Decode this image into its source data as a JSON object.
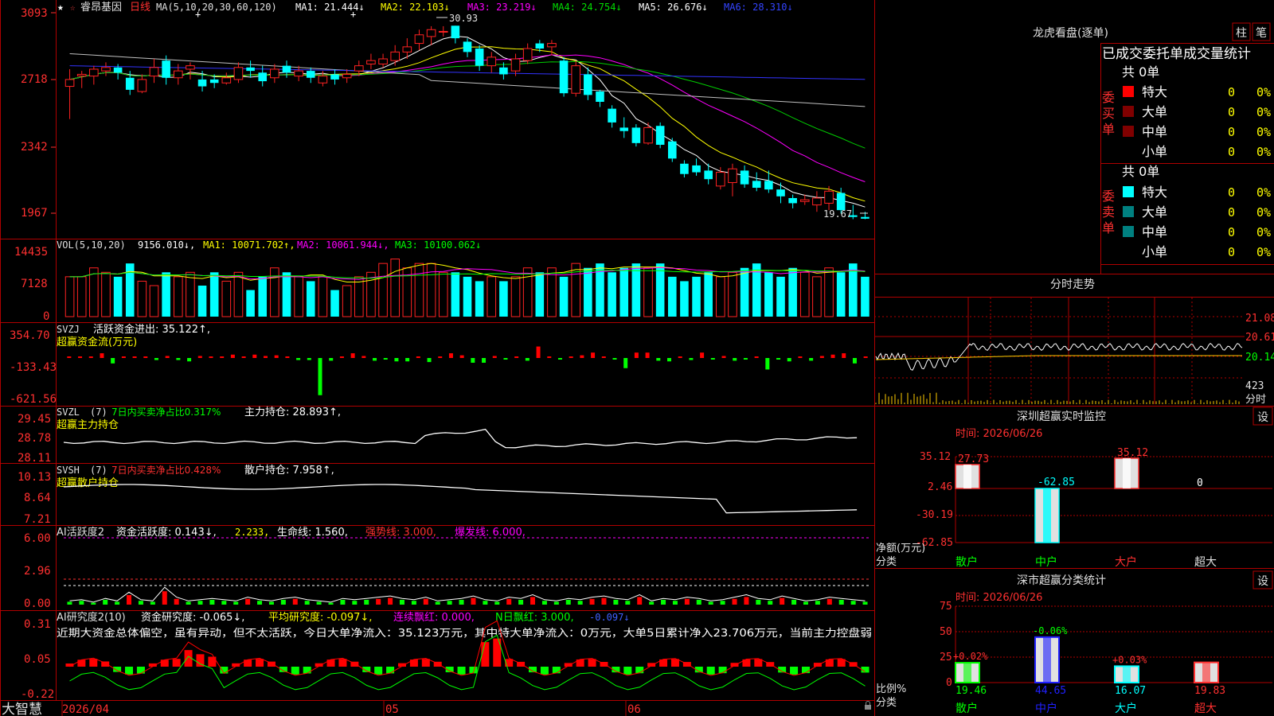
{
  "window": {
    "stock_name": "睿昂基因",
    "period": "日线",
    "brand": "大智慧",
    "star_icon": "star-icon",
    "lock_icon": "lock-icon"
  },
  "colors": {
    "up": "#ff2222",
    "down": "#00ffff",
    "frame": "#b00000",
    "ma1": "#ffffff",
    "ma2": "#ffff00",
    "ma3": "#ff00ff",
    "ma4": "#00cc00",
    "ma5": "#c0c0c0",
    "ma6": "#3333ff"
  },
  "kline": {
    "ma_header": "MA(5,10,20,30,60,120)",
    "ma1": "MA1: 21.444↓",
    "ma2": "MA2: 22.103↓",
    "ma3": "MA3: 23.219↓",
    "ma4": "MA4: 24.754↓",
    "ma5": "MA5: 26.676↓",
    "ma6": "MA6: 28.310↓",
    "yticks": [
      "3093",
      "2718",
      "2342",
      "1967"
    ],
    "high_label": "30.93",
    "low_label": "19.67",
    "candles": [
      {
        "o": 27.4,
        "c": 27.8,
        "h": 28.4,
        "l": 25.5
      },
      {
        "o": 28.0,
        "c": 28.1,
        "h": 28.3,
        "l": 27.3
      },
      {
        "o": 28.0,
        "c": 28.4,
        "h": 28.6,
        "l": 27.5
      },
      {
        "o": 28.3,
        "c": 28.5,
        "h": 28.8,
        "l": 28.0
      },
      {
        "o": 28.5,
        "c": 28.2,
        "h": 28.7,
        "l": 27.8
      },
      {
        "o": 27.9,
        "c": 27.2,
        "h": 28.3,
        "l": 26.9
      },
      {
        "o": 27.1,
        "c": 27.8,
        "h": 28.1,
        "l": 27.0
      },
      {
        "o": 28.0,
        "c": 28.5,
        "h": 29.0,
        "l": 27.6
      },
      {
        "o": 28.9,
        "c": 27.9,
        "h": 29.2,
        "l": 27.5
      },
      {
        "o": 27.9,
        "c": 28.3,
        "h": 28.7,
        "l": 27.5
      },
      {
        "o": 28.4,
        "c": 28.6,
        "h": 28.8,
        "l": 27.8
      },
      {
        "o": 27.8,
        "c": 27.4,
        "h": 28.3,
        "l": 27.1
      },
      {
        "o": 27.8,
        "c": 27.6,
        "h": 28.1,
        "l": 27.3
      },
      {
        "o": 27.6,
        "c": 27.9,
        "h": 28.2,
        "l": 27.5
      },
      {
        "o": 27.8,
        "c": 28.5,
        "h": 28.8,
        "l": 27.6
      },
      {
        "o": 28.5,
        "c": 28.3,
        "h": 28.9,
        "l": 27.9
      },
      {
        "o": 28.2,
        "c": 27.7,
        "h": 28.6,
        "l": 27.4
      },
      {
        "o": 27.9,
        "c": 28.4,
        "h": 28.7,
        "l": 27.6
      },
      {
        "o": 28.6,
        "c": 28.2,
        "h": 28.9,
        "l": 27.9
      },
      {
        "o": 28.0,
        "c": 28.3,
        "h": 28.6,
        "l": 27.7
      },
      {
        "o": 28.3,
        "c": 27.9,
        "h": 28.5,
        "l": 27.6
      },
      {
        "o": 27.6,
        "c": 28.0,
        "h": 28.3,
        "l": 27.4
      },
      {
        "o": 28.1,
        "c": 27.8,
        "h": 28.4,
        "l": 27.5
      },
      {
        "o": 27.9,
        "c": 28.1,
        "h": 28.4,
        "l": 27.6
      },
      {
        "o": 28.3,
        "c": 28.6,
        "h": 28.9,
        "l": 28.0
      },
      {
        "o": 28.7,
        "c": 28.9,
        "h": 29.3,
        "l": 28.4
      },
      {
        "o": 28.7,
        "c": 29.0,
        "h": 29.3,
        "l": 28.5
      },
      {
        "o": 28.9,
        "c": 29.4,
        "h": 29.8,
        "l": 28.6
      },
      {
        "o": 29.4,
        "c": 29.7,
        "h": 30.2,
        "l": 29.0
      },
      {
        "o": 29.9,
        "c": 30.4,
        "h": 30.7,
        "l": 29.5
      },
      {
        "o": 30.3,
        "c": 30.7,
        "h": 30.9,
        "l": 29.8
      },
      {
        "o": 30.6,
        "c": 30.6,
        "h": 30.9,
        "l": 30.3
      },
      {
        "o": 30.93,
        "c": 30.2,
        "h": 30.93,
        "l": 29.9
      },
      {
        "o": 30.0,
        "c": 29.4,
        "h": 30.2,
        "l": 29.1
      },
      {
        "o": 29.6,
        "c": 28.6,
        "h": 29.8,
        "l": 28.3
      },
      {
        "o": 28.6,
        "c": 29.1,
        "h": 29.4,
        "l": 28.2
      },
      {
        "o": 28.5,
        "c": 28.1,
        "h": 28.8,
        "l": 27.8
      },
      {
        "o": 28.3,
        "c": 29.0,
        "h": 29.3,
        "l": 28.0
      },
      {
        "o": 28.9,
        "c": 29.6,
        "h": 29.9,
        "l": 28.7
      },
      {
        "o": 29.9,
        "c": 29.6,
        "h": 30.1,
        "l": 29.4
      },
      {
        "o": 29.7,
        "c": 29.9,
        "h": 30.1,
        "l": 29.2
      },
      {
        "o": 28.9,
        "c": 27.0,
        "h": 29.1,
        "l": 26.8
      },
      {
        "o": 27.0,
        "c": 28.6,
        "h": 28.9,
        "l": 26.8
      },
      {
        "o": 28.1,
        "c": 26.9,
        "h": 28.5,
        "l": 26.6
      },
      {
        "o": 27.1,
        "c": 26.5,
        "h": 27.2,
        "l": 26.2
      },
      {
        "o": 26.1,
        "c": 25.3,
        "h": 26.3,
        "l": 25.0
      },
      {
        "o": 25.0,
        "c": 24.8,
        "h": 25.6,
        "l": 24.4
      },
      {
        "o": 25.0,
        "c": 24.1,
        "h": 25.2,
        "l": 23.9
      },
      {
        "o": 24.1,
        "c": 25.0,
        "h": 25.3,
        "l": 24.0
      },
      {
        "o": 25.1,
        "c": 24.0,
        "h": 25.3,
        "l": 23.8
      },
      {
        "o": 24.2,
        "c": 23.2,
        "h": 24.4,
        "l": 23.0
      },
      {
        "o": 22.9,
        "c": 22.3,
        "h": 23.1,
        "l": 22.1
      },
      {
        "o": 22.8,
        "c": 22.4,
        "h": 23.2,
        "l": 22.2
      },
      {
        "o": 22.5,
        "c": 22.0,
        "h": 22.9,
        "l": 21.7
      },
      {
        "o": 21.6,
        "c": 22.4,
        "h": 22.7,
        "l": 21.4
      },
      {
        "o": 21.8,
        "c": 22.6,
        "h": 22.9,
        "l": 21.0
      },
      {
        "o": 22.5,
        "c": 21.7,
        "h": 22.8,
        "l": 21.5
      },
      {
        "o": 21.9,
        "c": 21.5,
        "h": 22.4,
        "l": 21.3
      },
      {
        "o": 21.9,
        "c": 21.4,
        "h": 22.5,
        "l": 21.2
      },
      {
        "o": 21.4,
        "c": 21.0,
        "h": 21.8,
        "l": 20.6
      },
      {
        "o": 20.9,
        "c": 20.6,
        "h": 21.1,
        "l": 20.3
      },
      {
        "o": 20.7,
        "c": 20.8,
        "h": 21.1,
        "l": 20.5
      },
      {
        "o": 20.5,
        "c": 20.9,
        "h": 21.3,
        "l": 20.1
      },
      {
        "o": 20.6,
        "c": 21.3,
        "h": 21.6,
        "l": 20.2
      },
      {
        "o": 21.2,
        "c": 20.2,
        "h": 21.5,
        "l": 20.0
      },
      {
        "o": 19.9,
        "c": 19.8,
        "h": 20.5,
        "l": 19.67
      },
      {
        "o": 19.8,
        "c": 19.7,
        "h": 20.1,
        "l": 19.67
      }
    ]
  },
  "vol": {
    "header": "VOL(5,10,20)",
    "value": "9156.010↓,",
    "ma1": "MA1: 10071.702↑,",
    "ma2": "MA2: 10061.944↓,",
    "ma3": "MA3: 10100.062↓",
    "yticks": [
      "14435",
      "7128",
      "0"
    ],
    "bars": [
      9,
      9,
      11,
      10,
      9,
      12,
      8,
      7,
      10,
      9,
      10,
      7,
      10,
      8,
      10,
      6,
      9,
      11,
      10,
      9,
      8,
      9,
      6,
      7,
      9,
      10,
      12,
      13,
      11,
      12,
      12,
      10,
      10,
      9,
      8,
      9,
      8,
      9,
      11,
      10,
      11,
      9,
      12,
      11,
      12,
      10,
      11,
      12,
      11,
      12,
      9,
      8,
      9,
      10,
      9,
      10,
      11,
      12,
      10,
      9,
      11,
      10,
      9,
      11,
      10,
      12,
      9
    ]
  },
  "svzj": {
    "name": "SVZJ",
    "label": "活跃资金进出: 35.122↑,",
    "sub": "超赢资金流(万元)",
    "yticks": [
      "354.70",
      "-133.43",
      "-621.56"
    ],
    "bars": [
      10,
      10,
      10,
      70,
      -80,
      10,
      10,
      10,
      -30,
      30,
      -30,
      -50,
      30,
      20,
      20,
      50,
      5,
      50,
      30,
      40,
      10,
      -30,
      -30,
      -550,
      -40,
      10,
      70,
      30,
      -40,
      -20,
      -50,
      -50,
      10,
      -60,
      10,
      70,
      40,
      -70,
      -70,
      30,
      -20,
      5,
      -40,
      170,
      5,
      -10,
      10,
      40,
      80,
      5,
      -20,
      -150,
      80,
      80,
      -40,
      -50,
      5,
      -30,
      80,
      -10,
      30,
      -40,
      -10,
      20,
      -170,
      -20,
      -50,
      20,
      -40,
      30,
      50,
      70,
      -80,
      10
    ]
  },
  "svzl": {
    "name": "SVZL",
    "params": "(7)",
    "label": "7日内买卖净占比0.317%",
    "value": "主力持仓: 28.893↑,",
    "sub": "超赢主力持仓",
    "yticks": [
      "29.45",
      "28.78",
      "28.11"
    ]
  },
  "svsh": {
    "name": "SVSH",
    "params": "(7)",
    "label": "7日内买卖净占比0.428%",
    "value": "散户持仓: 7.958↑,",
    "sub": "超赢散户持仓",
    "yticks": [
      "10.13",
      "8.64",
      "7.21"
    ]
  },
  "ai_active": {
    "name": "AI活跃度2",
    "l1": "资金活跃度: 0.143↓,",
    "l2": "2.233,",
    "l3": "生命线: 1.560,",
    "l4": "强势线: 3.000,",
    "l5": "爆发线: 6.000,",
    "yticks": [
      "6.00",
      "2.96",
      "0.00"
    ],
    "bars": [
      0.3,
      0.4,
      0.2,
      0.5,
      0.3,
      1.0,
      0.4,
      0.3,
      1.4,
      0.6,
      0.3,
      0.4,
      0.5,
      0.4,
      0.3,
      0.6,
      0.4,
      0.3,
      0.5,
      0.6,
      0.4,
      0.3,
      0.2,
      0.5,
      0.4,
      0.5,
      0.6,
      0.7,
      0.5,
      0.4,
      0.6,
      0.3,
      0.4,
      0.5,
      0.7,
      0.4,
      0.3,
      0.6,
      0.5,
      0.8,
      0.4,
      0.3,
      0.5,
      0.4,
      0.6,
      0.7,
      0.5,
      0.4,
      0.8,
      0.3,
      0.5,
      0.4,
      0.6,
      0.5,
      0.3,
      0.4,
      0.6,
      0.8,
      0.5,
      0.4,
      0.7,
      0.5,
      0.3,
      0.4,
      0.6,
      0.5,
      0.4,
      0.3
    ]
  },
  "ai_research": {
    "name": "AI研究度2(10)",
    "l1": "资金研究度: -0.065↓,",
    "l2": "平均研究度: -0.097↓,",
    "l3": "连续飘红: 0.000,",
    "l4": "N日飘红: 3.000,",
    "l5": "-0.097↓",
    "commentary": "近期大资金总体偏空，虽有异动，但不太活跃，今日大单净流入：35.123万元，其中特大单净流入：0万元，大单5日累计净入23.706万元，当前主力控盘弱",
    "yticks": [
      "0.31",
      "0.05",
      "-0.22"
    ]
  },
  "xaxis": {
    "labels": [
      "2026/04",
      "05",
      "06"
    ]
  },
  "longhu": {
    "title": "龙虎看盘(逐单)",
    "btn_bar": "柱",
    "btn_pen": "笔",
    "header": "已成交委托单成交量统计",
    "buy_label": "委买单",
    "sell_label": "委卖单",
    "buy_total": "共 0单",
    "sell_total": "共 0单",
    "buy_rows": [
      {
        "name": "特大",
        "count": "0",
        "pct": "0%",
        "color": "#ff0000"
      },
      {
        "name": "大单",
        "count": "0",
        "pct": "0%",
        "color": "#800000"
      },
      {
        "name": "中单",
        "count": "0",
        "pct": "0%",
        "color": "#800000"
      },
      {
        "name": "小单",
        "count": "0",
        "pct": "0%",
        "color": "#000000"
      }
    ],
    "sell_rows": [
      {
        "name": "特大",
        "count": "0",
        "pct": "0%",
        "color": "#00ffff"
      },
      {
        "name": "大单",
        "count": "0",
        "pct": "0%",
        "color": "#008080"
      },
      {
        "name": "中单",
        "count": "0",
        "pct": "0%",
        "color": "#008080"
      },
      {
        "name": "小单",
        "count": "0",
        "pct": "0%",
        "color": "#000000"
      }
    ]
  },
  "intraday": {
    "title": "分时走势",
    "yticks": [
      "21.08",
      "20.61",
      "20.14"
    ],
    "vol_label": "423",
    "vol_unit": "分时"
  },
  "monitor": {
    "title": "深圳超赢实时监控",
    "btn": "设",
    "time": "时间: 2026/06/26",
    "yticks": [
      "35.12",
      "2.46",
      "-30.19",
      "-62.85"
    ],
    "yunit1": "净额(万元)",
    "yunit2": "分类",
    "bars": [
      {
        "cat": "散户",
        "value": 27.73,
        "label": "27.73"
      },
      {
        "cat": "中户",
        "value": -62.85,
        "label": "-62.85"
      },
      {
        "cat": "大户",
        "value": 35.12,
        "label": "35.12"
      },
      {
        "cat": "超大",
        "value": 0,
        "label": "0"
      }
    ]
  },
  "classify": {
    "title": "深市超赢分类统计",
    "btn": "设",
    "time": "时间: 2026/06/26",
    "yticks": [
      "75",
      "50",
      "25",
      "0"
    ],
    "yunit1": "比例%",
    "yunit2": "分类",
    "bars": [
      {
        "cat": "散户",
        "value": 19.46,
        "label": "19.46",
        "delta": "+0.02%"
      },
      {
        "cat": "中户",
        "value": 44.65,
        "label": "44.65",
        "delta": "-0.06%"
      },
      {
        "cat": "大户",
        "value": 16.07,
        "label": "16.07",
        "delta": "+0.03%"
      },
      {
        "cat": "超大",
        "value": 19.83,
        "label": "19.83",
        "delta": ""
      }
    ]
  },
  "chart_data": [
    {
      "type": "candlestick",
      "title": "睿昂基因 日线",
      "ylim": [
        19.0,
        31.5
      ],
      "yticks": [
        "3093",
        "2718",
        "2342",
        "1967"
      ],
      "ohlc_source": "kline.candles",
      "annotations": [
        "30.93",
        "19.67"
      ]
    },
    {
      "type": "bar",
      "title": "VOL(5,10,20)",
      "yticks": [
        "14435",
        "7128",
        "0"
      ]
    },
    {
      "type": "bar",
      "title": "深圳超赢实时监控",
      "categories": [
        "散户",
        "中户",
        "大户",
        "超大"
      ],
      "values": [
        27.73,
        -62.85,
        35.12,
        0
      ],
      "ylabel": "净额(万元)",
      "xlabel": "分类"
    },
    {
      "type": "bar",
      "title": "深市超赢分类统计",
      "categories": [
        "散户",
        "中户",
        "大户",
        "超大"
      ],
      "values": [
        19.46,
        44.65,
        16.07,
        19.83
      ],
      "ylabel": "比例%",
      "xlabel": "分类",
      "ylim": [
        0,
        75
      ]
    }
  ]
}
